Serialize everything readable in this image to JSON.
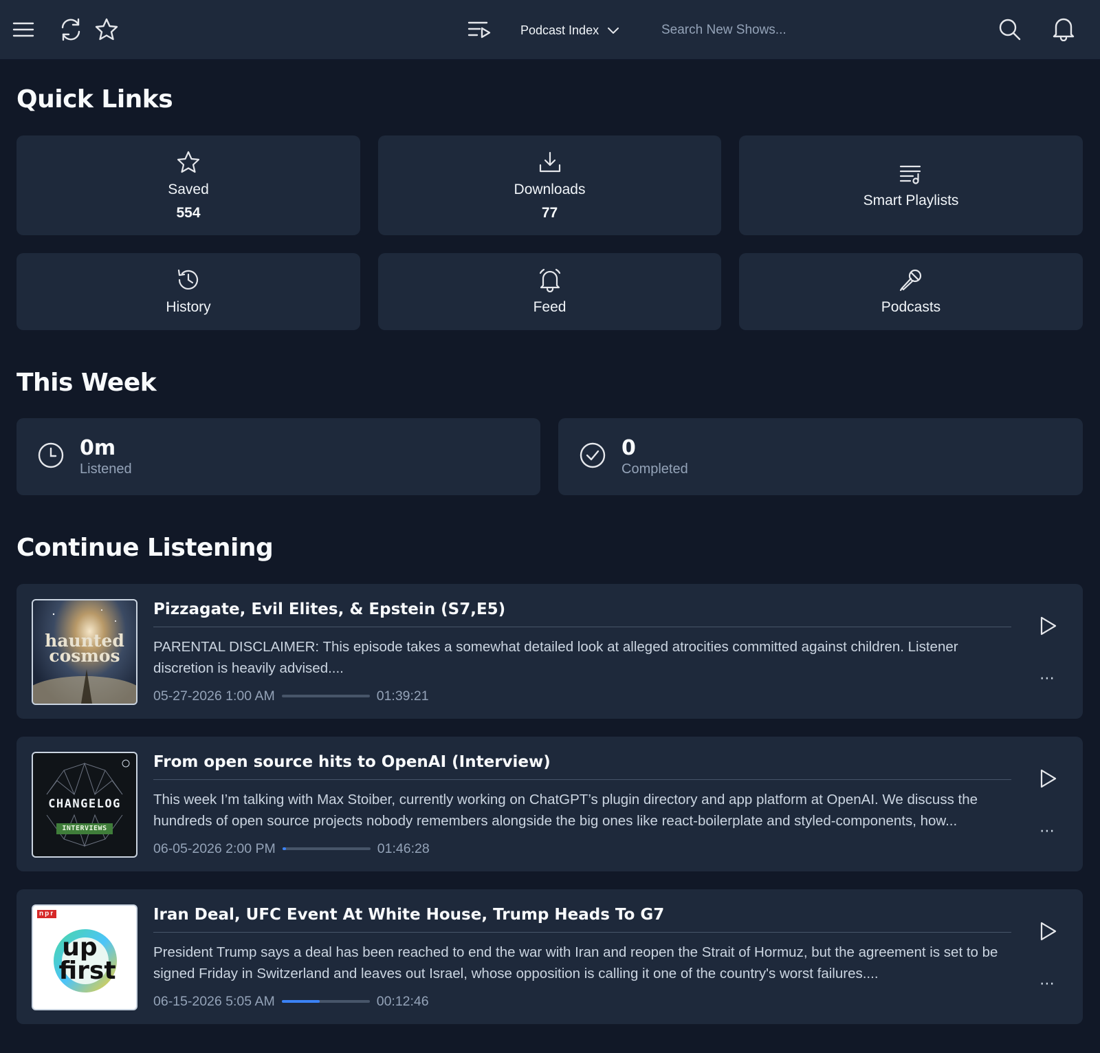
{
  "topbar": {
    "source_label": "Podcast Index",
    "search_placeholder": "Search New Shows..."
  },
  "quick_links": {
    "title": "Quick Links",
    "items": [
      {
        "label": "Saved",
        "count": "554",
        "icon": "star-icon"
      },
      {
        "label": "Downloads",
        "count": "77",
        "icon": "download-icon"
      },
      {
        "label": "Smart Playlists",
        "icon": "playlist-icon"
      },
      {
        "label": "History",
        "icon": "history-icon"
      },
      {
        "label": "Feed",
        "icon": "bell-icon"
      },
      {
        "label": "Podcasts",
        "icon": "microphone-icon"
      }
    ]
  },
  "this_week": {
    "title": "This Week",
    "listened": {
      "value": "0m",
      "label": "Listened"
    },
    "completed": {
      "value": "0",
      "label": "Completed"
    }
  },
  "continue_listening": {
    "title": "Continue Listening",
    "episodes": [
      {
        "title": "Pizzagate, Evil Elites, & Epstein (S7,E5)",
        "description": "PARENTAL DISCLAIMER: This episode takes a somewhat detailed look at alleged atrocities committed against children. Listener discretion is heavily advised....",
        "date": "05-27-2026 1:00 AM",
        "duration": "01:39:21",
        "progress": 0.0,
        "art_text": [
          "haunted",
          "cosmos"
        ]
      },
      {
        "title": "From open source hits to OpenAI (Interview)",
        "description": "This week I’m talking with Max Stoiber, currently working on ChatGPT’s plugin directory and app platform at OpenAI. We discuss the hundreds of open source projects nobody remembers alongside the big ones like react-boilerplate and styled-components, how...",
        "date": "06-05-2026 2:00 PM",
        "duration": "01:46:28",
        "progress": 0.04,
        "art_text": [
          "CHANGELOG",
          "INTERVIEWS"
        ]
      },
      {
        "title": "Iran Deal, UFC Event At White House, Trump Heads To G7",
        "description": "President Trump says a deal has been reached to end the war with Iran and reopen the Strait of Hormuz, but the agreement is set to be signed Friday in Switzerland and leaves out Israel, whose opposition is calling it one of the country's worst failures....",
        "date": "06-15-2026 5:05 AM",
        "duration": "00:12:46",
        "progress": 0.43,
        "art_text": [
          "npr",
          "up",
          "first"
        ]
      }
    ]
  },
  "colors": {
    "background": "#111827",
    "card": "#1e293b",
    "accent": "#3b82f6",
    "muted_text": "#94a3b8"
  }
}
